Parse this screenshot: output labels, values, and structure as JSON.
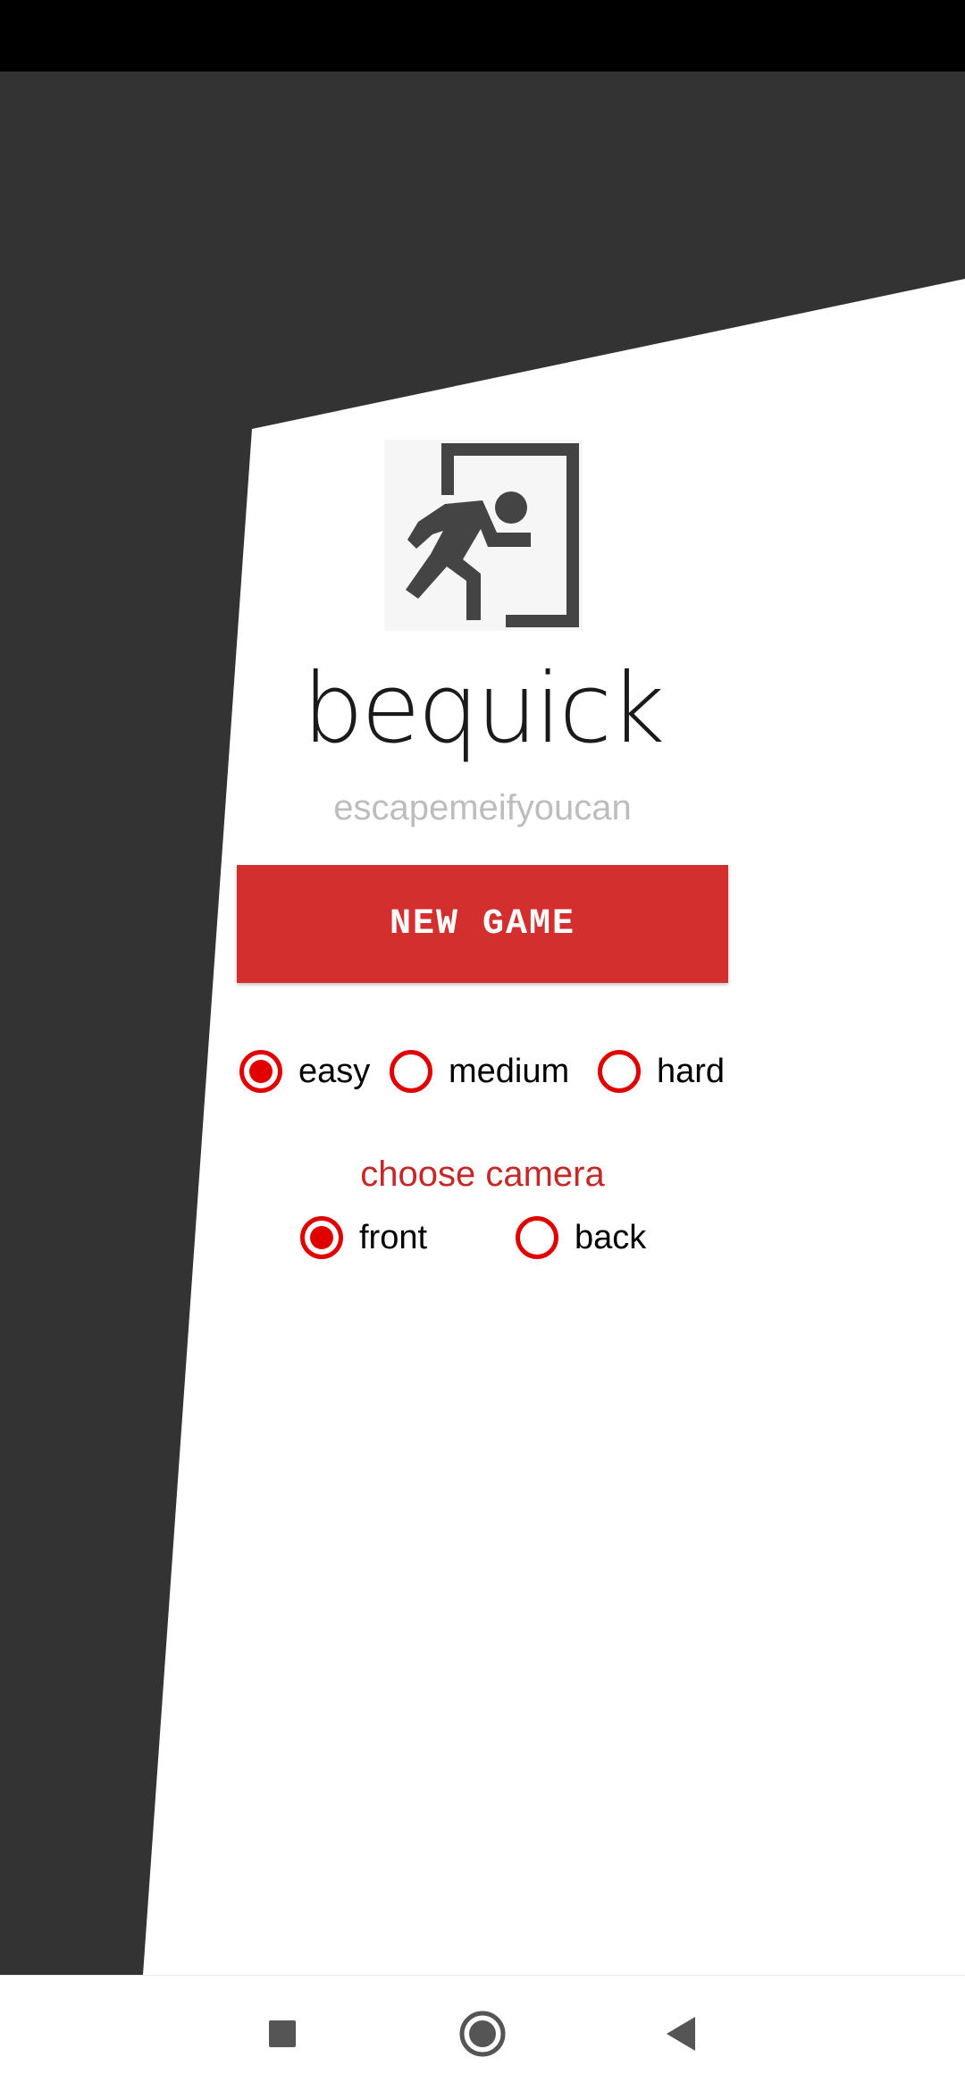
{
  "app": {
    "title": "bequick",
    "subtitle": "escapemeifyoucan",
    "logo_icon": "emergency-exit-running-man-icon"
  },
  "actions": {
    "new_game_label": "NEW GAME"
  },
  "difficulty": {
    "options": [
      {
        "label": "easy",
        "selected": true
      },
      {
        "label": "medium",
        "selected": false
      },
      {
        "label": "hard",
        "selected": false
      }
    ]
  },
  "camera": {
    "heading": "choose camera",
    "options": [
      {
        "label": "front",
        "selected": true
      },
      {
        "label": "back",
        "selected": false
      }
    ]
  },
  "navigation": {
    "recents_icon": "square-recents-icon",
    "home_icon": "circle-home-icon",
    "back_icon": "triangle-back-icon"
  },
  "colors": {
    "background_dark": "#333333",
    "panel": "#ffffff",
    "accent": "#D32F2F",
    "radio": "#E00000",
    "heading_accent": "#C62828"
  }
}
